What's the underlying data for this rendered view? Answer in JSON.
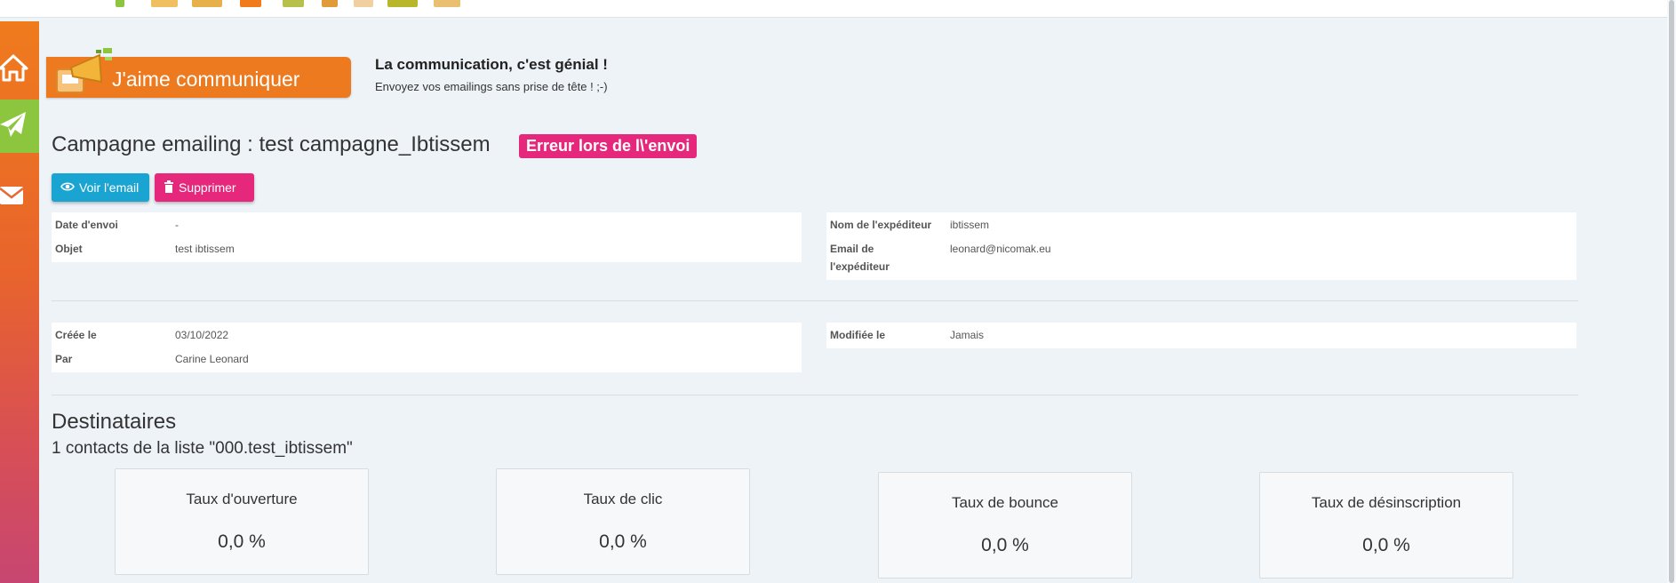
{
  "header": {
    "brand_colors": {
      "orange": "#ee7a1f",
      "green": "#8cc63f",
      "pink": "#e5287c",
      "blue": "#1aa4d1"
    }
  },
  "sidebar": {
    "items": [
      {
        "name": "home-icon"
      },
      {
        "name": "paper-plane-icon"
      },
      {
        "name": "envelope-icon"
      }
    ]
  },
  "banner": {
    "title": "J'aime communiquer",
    "slogan_title": "La communication, c'est génial !",
    "slogan_sub": "Envoyez vos emailings sans prise de tête ! ;-)"
  },
  "campaign": {
    "title": "Campagne emailing : test campagne_Ibtissem",
    "status": "Erreur lors de l\\'envoi"
  },
  "actions": {
    "view_label": "Voir l'email",
    "delete_label": "Supprimer"
  },
  "details": {
    "send_date_label": "Date d'envoi",
    "send_date_value": "-",
    "subject_label": "Objet",
    "subject_value": "test ibtissem",
    "sender_name_label": "Nom de l'expéditeur",
    "sender_name_value": "ibtissem",
    "sender_email_label_1": "Email de",
    "sender_email_label_2": "l'expéditeur",
    "sender_email_value": "leonard@nicomak.eu"
  },
  "meta": {
    "created_label": "Créée le",
    "created_value": "03/10/2022",
    "by_label": "Par",
    "by_value": "Carine Leonard",
    "modified_label": "Modifiée le",
    "modified_value": "Jamais"
  },
  "recipients": {
    "title": "Destinataires",
    "summary": "1 contacts de la liste \"000.test_ibtissem\""
  },
  "stats": [
    {
      "label": "Taux d'ouverture",
      "value": "0,0 %"
    },
    {
      "label": "Taux de clic",
      "value": "0,0 %"
    },
    {
      "label": "Taux de bounce",
      "value": "0,0 %"
    },
    {
      "label": "Taux de désinscription",
      "value": "0,0 %"
    }
  ]
}
